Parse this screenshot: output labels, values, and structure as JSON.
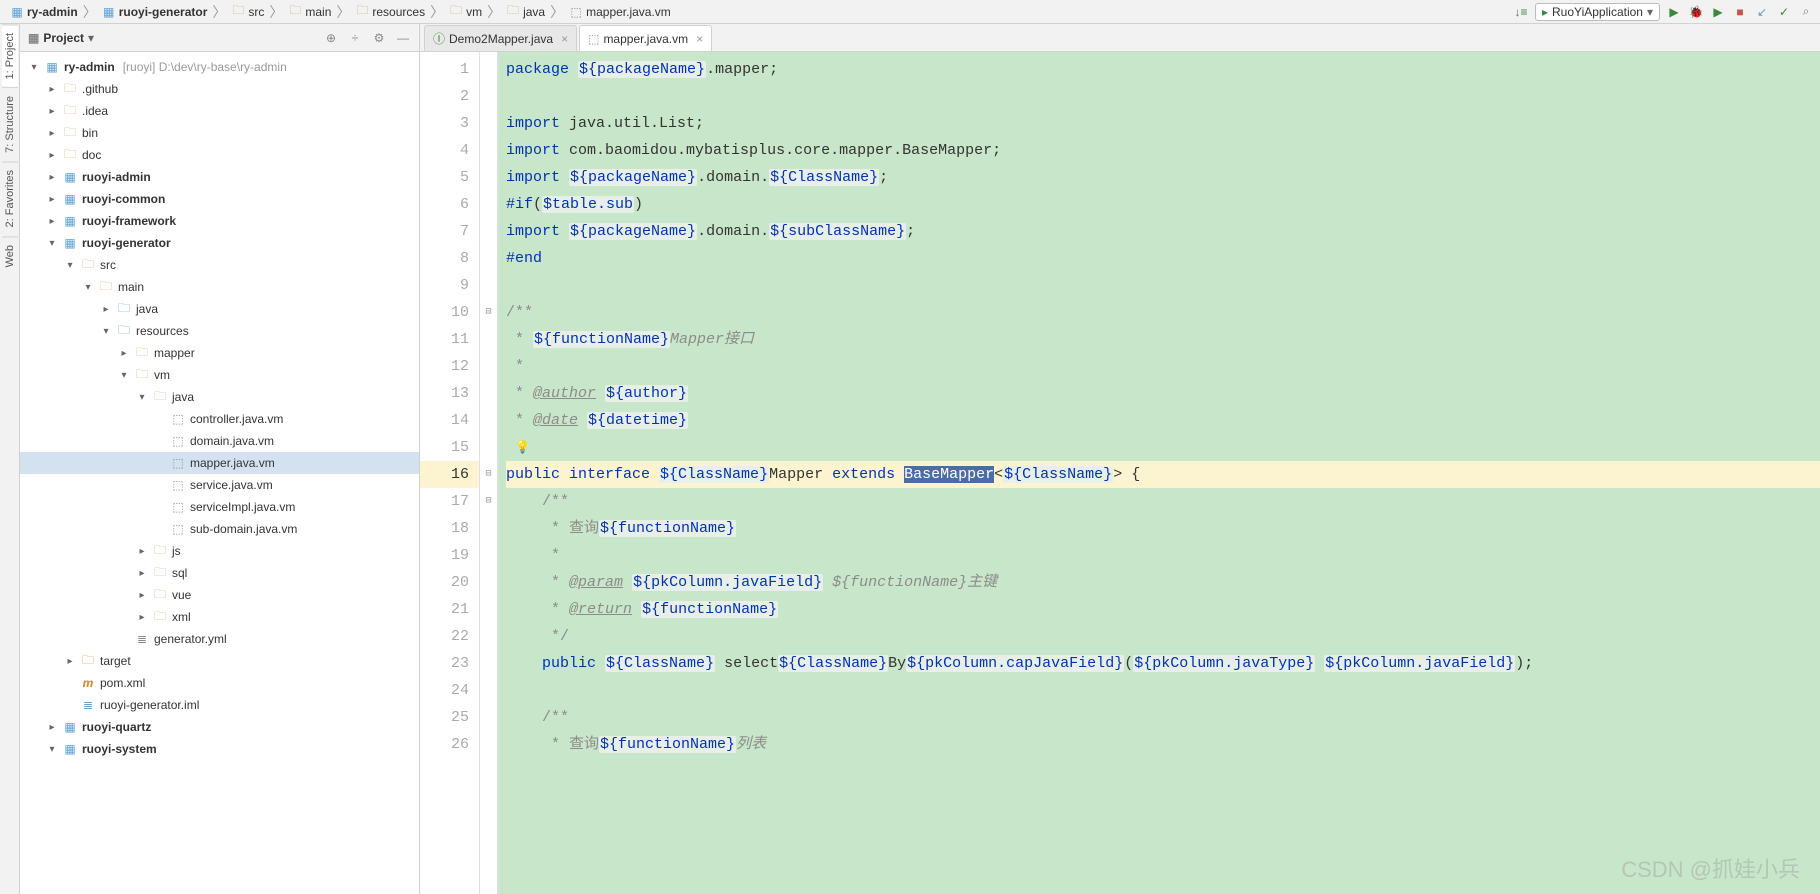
{
  "breadcrumbs": [
    "ry-admin",
    "ruoyi-generator",
    "src",
    "main",
    "resources",
    "vm",
    "java",
    "mapper.java.vm"
  ],
  "run_config": "RuoYiApplication",
  "project_panel": {
    "title": "Project"
  },
  "tree": [
    {
      "d": 0,
      "a": "v",
      "i": "module",
      "l": "ry-admin",
      "bold": true,
      "hint": "[ruoyi]  D:\\dev\\ry-base\\ry-admin"
    },
    {
      "d": 1,
      "a": ">",
      "i": "folder",
      "l": ".github"
    },
    {
      "d": 1,
      "a": ">",
      "i": "folder",
      "l": ".idea"
    },
    {
      "d": 1,
      "a": ">",
      "i": "folder",
      "l": "bin"
    },
    {
      "d": 1,
      "a": ">",
      "i": "folder",
      "l": "doc"
    },
    {
      "d": 1,
      "a": ">",
      "i": "module",
      "l": "ruoyi-admin",
      "bold": true
    },
    {
      "d": 1,
      "a": ">",
      "i": "module",
      "l": "ruoyi-common",
      "bold": true
    },
    {
      "d": 1,
      "a": ">",
      "i": "module",
      "l": "ruoyi-framework",
      "bold": true
    },
    {
      "d": 1,
      "a": "v",
      "i": "module",
      "l": "ruoyi-generator",
      "bold": true
    },
    {
      "d": 2,
      "a": "v",
      "i": "folder",
      "l": "src"
    },
    {
      "d": 3,
      "a": "v",
      "i": "folder",
      "l": "main"
    },
    {
      "d": 4,
      "a": ">",
      "i": "folder-sp",
      "l": "java"
    },
    {
      "d": 4,
      "a": "v",
      "i": "folder-sp",
      "l": "resources"
    },
    {
      "d": 5,
      "a": ">",
      "i": "folder",
      "l": "mapper"
    },
    {
      "d": 5,
      "a": "v",
      "i": "folder",
      "l": "vm"
    },
    {
      "d": 6,
      "a": "v",
      "i": "folder",
      "l": "java"
    },
    {
      "d": 7,
      "a": "",
      "i": "vm",
      "l": "controller.java.vm"
    },
    {
      "d": 7,
      "a": "",
      "i": "vm",
      "l": "domain.java.vm"
    },
    {
      "d": 7,
      "a": "",
      "i": "vm",
      "l": "mapper.java.vm",
      "sel": true
    },
    {
      "d": 7,
      "a": "",
      "i": "vm",
      "l": "service.java.vm"
    },
    {
      "d": 7,
      "a": "",
      "i": "vm",
      "l": "serviceImpl.java.vm"
    },
    {
      "d": 7,
      "a": "",
      "i": "vm",
      "l": "sub-domain.java.vm"
    },
    {
      "d": 6,
      "a": ">",
      "i": "folder",
      "l": "js"
    },
    {
      "d": 6,
      "a": ">",
      "i": "folder",
      "l": "sql"
    },
    {
      "d": 6,
      "a": ">",
      "i": "folder",
      "l": "vue"
    },
    {
      "d": 6,
      "a": ">",
      "i": "folder",
      "l": "xml"
    },
    {
      "d": 5,
      "a": "",
      "i": "yml",
      "l": "generator.yml"
    },
    {
      "d": 2,
      "a": ">",
      "i": "folder-ex",
      "l": "target"
    },
    {
      "d": 2,
      "a": "",
      "i": "pom",
      "l": "pom.xml"
    },
    {
      "d": 2,
      "a": "",
      "i": "iml",
      "l": "ruoyi-generator.iml"
    },
    {
      "d": 1,
      "a": ">",
      "i": "module",
      "l": "ruoyi-quartz",
      "bold": true
    },
    {
      "d": 1,
      "a": "v",
      "i": "module",
      "l": "ruoyi-system",
      "bold": true
    }
  ],
  "tabs": [
    {
      "icon": "java",
      "label": "Demo2Mapper.java",
      "active": false
    },
    {
      "icon": "vm",
      "label": "mapper.java.vm",
      "active": true
    }
  ],
  "side_tabs": [
    "1: Project",
    "7: Structure",
    "2: Favorites",
    "Web"
  ],
  "code": [
    {
      "n": 1,
      "h": "<span class='kw'>package</span> <span class='var'>${packageName}</span><span class='txt'>.mapper;</span>"
    },
    {
      "n": 2,
      "h": ""
    },
    {
      "n": 3,
      "h": "<span class='kw'>import</span> <span class='txt'>java.util.List;</span>"
    },
    {
      "n": 4,
      "h": "<span class='kw'>import</span> <span class='txt'>com.baomidou.mybatisplus.core.mapper.BaseMapper;</span>"
    },
    {
      "n": 5,
      "h": "<span class='kw'>import</span> <span class='var'>${packageName}</span><span class='txt'>.domain.</span><span class='var'>${ClassName}</span><span class='txt'>;</span>"
    },
    {
      "n": 6,
      "h": "<span class='kw'>#if</span><span class='txt'>(</span><span class='var'>$table.sub</span><span class='txt'>)</span>"
    },
    {
      "n": 7,
      "h": "<span class='kw'>import</span> <span class='var'>${packageName}</span><span class='txt'>.domain.</span><span class='var'>${subClassName}</span><span class='txt'>;</span>"
    },
    {
      "n": 8,
      "h": "<span class='kw'>#end</span>"
    },
    {
      "n": 9,
      "h": ""
    },
    {
      "n": 10,
      "h": "<span class='doc'>/**</span>"
    },
    {
      "n": 11,
      "h": "<span class='doc'> * </span><span class='var'>${functionName}</span><span class='cmt'>Mapper接口</span>"
    },
    {
      "n": 12,
      "h": "<span class='doc'> *</span>"
    },
    {
      "n": 13,
      "h": "<span class='doc'> * </span><span class='doctag'>@author</span><span class='doc'> </span><span class='var'>${author}</span>"
    },
    {
      "n": 14,
      "h": "<span class='doc'> * </span><span class='doctag'>@date</span><span class='doc'> </span><span class='var'>${datetime}</span>"
    },
    {
      "n": 15,
      "h": "<span class='doc'> </span><span class='bulb'>💡</span>"
    },
    {
      "n": 16,
      "cur": true,
      "h": "<span class='kw'>public interface</span> <span class='var'>${ClassName}</span><span class='txt'>Mapper </span><span class='kw'>extends</span> <span class='hl'>BaseMapper</span><span class='txt'>&lt;</span><span class='var'>${ClassName}</span><span class='txt'>&gt; {</span>"
    },
    {
      "n": 17,
      "h": "    <span class='doc'>/**</span>"
    },
    {
      "n": 18,
      "h": "    <span class='doc'> * 查询</span><span class='var'>${functionName}</span>"
    },
    {
      "n": 19,
      "h": "    <span class='doc'> *</span>"
    },
    {
      "n": 20,
      "h": "    <span class='doc'> * </span><span class='doctag'>@param</span><span class='doc'> </span><span class='var'>${pkColumn.javaField}</span> <span class='cmt'>${functionName}主键</span>"
    },
    {
      "n": 21,
      "h": "    <span class='doc'> * </span><span class='doctag'>@return</span><span class='doc'> </span><span class='var'>${functionName}</span>"
    },
    {
      "n": 22,
      "h": "    <span class='doc'> */</span>"
    },
    {
      "n": 23,
      "h": "    <span class='kw'>public</span> <span class='var'>${ClassName}</span> <span class='txt'>select</span><span class='var'>${ClassName}</span><span class='txt'>By</span><span class='var'>${pkColumn.capJavaField}</span><span class='txt'>(</span><span class='var'>${pkColumn.javaType}</span> <span class='var'>${pkColumn.javaField}</span><span class='txt'>);</span>"
    },
    {
      "n": 24,
      "h": ""
    },
    {
      "n": 25,
      "h": "    <span class='doc'>/**</span>"
    },
    {
      "n": 26,
      "h": "    <span class='doc'> * 查询</span><span class='var'>${functionName}</span><span class='cmt'>列表</span>"
    }
  ],
  "watermark": "CSDN @抓娃小兵"
}
